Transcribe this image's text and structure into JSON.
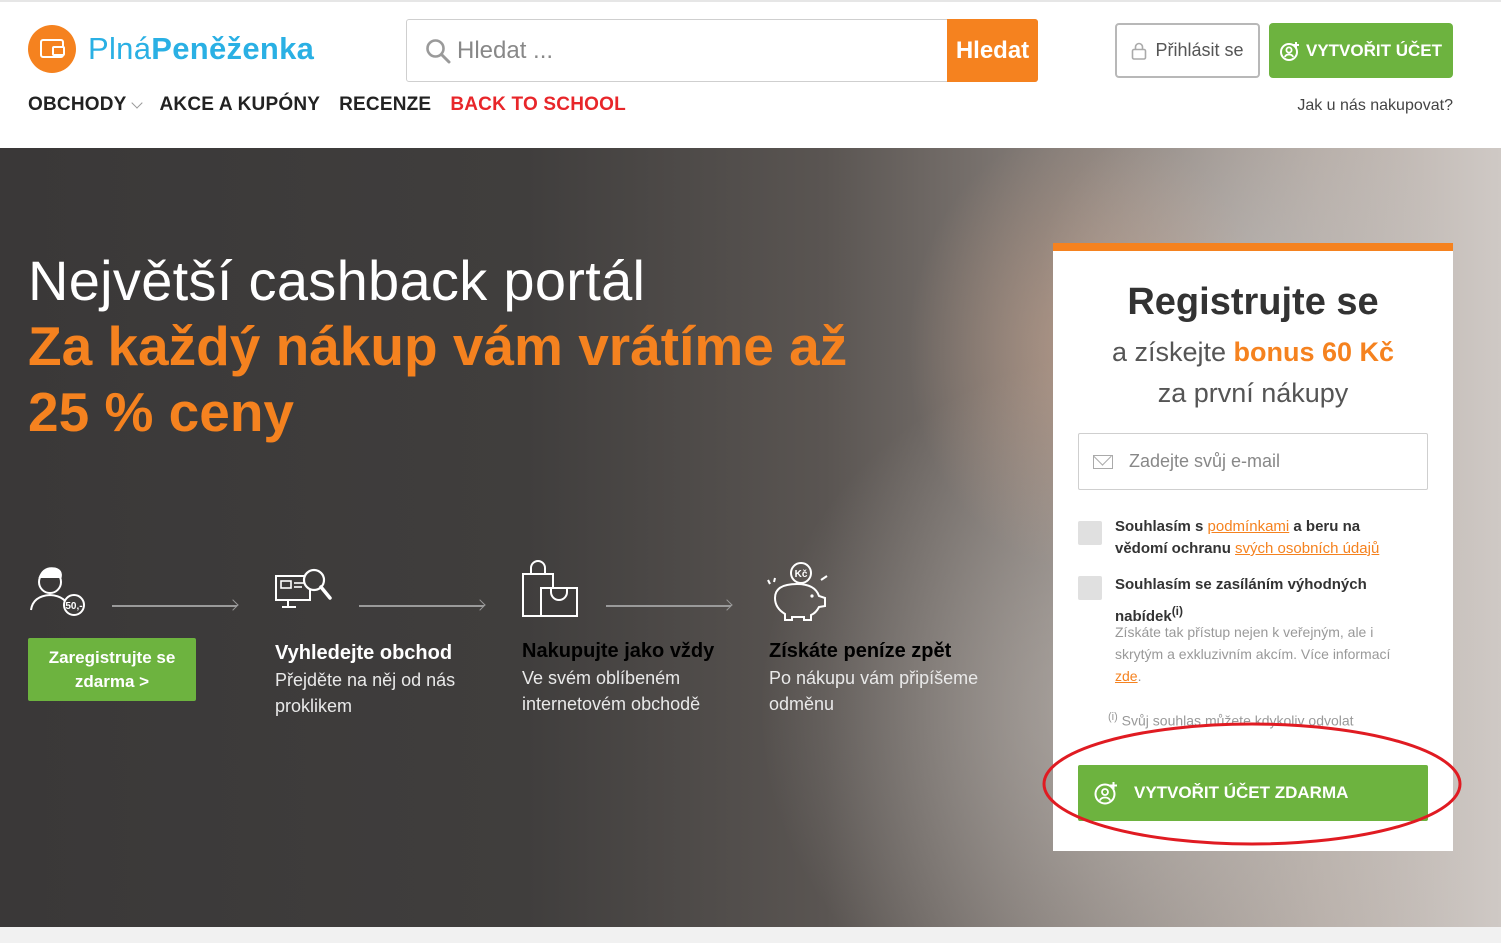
{
  "header": {
    "logo_part1": "Plná",
    "logo_part2": "Peněženka",
    "search_placeholder": "Hledat ...",
    "search_button": "Hledat",
    "login_label": "Přihlásit se",
    "create_account_label": "VYTVOŘIT ÚČET",
    "how_to_label": "Jak u nás nakupovat?",
    "nav": [
      {
        "label": "OBCHODY"
      },
      {
        "label": "AKCE A KUPÓNY"
      },
      {
        "label": "RECENZE"
      },
      {
        "label": "BACK TO SCHOOL"
      }
    ]
  },
  "hero": {
    "headline": "Největší cashback portál",
    "subheadline": "Za každý nákup vám vrátíme až 25 % ceny",
    "register_small": "Zaregistrujte se zdarma >",
    "steps": [
      {
        "icon": "user-coin-icon",
        "badge": "50,-"
      },
      {
        "icon": "search-shop-icon",
        "title": "Vyhledejte obchod",
        "desc": "Přejděte na něj od nás proklikem"
      },
      {
        "icon": "shopping-bag-icon",
        "title": "Nakupujte jako vždy",
        "desc": "Ve svém oblíbeném internetovém obchodě"
      },
      {
        "icon": "piggy-bank-icon",
        "title": "Získáte peníze zpět",
        "desc": "Po nákupu vám připíšeme odměnu",
        "badge": "Kč"
      }
    ]
  },
  "register": {
    "title": "Registrujte se",
    "sub_prefix": "a získejte ",
    "bonus": "bonus 60 Kč",
    "sub2": "za první nákupy",
    "email_placeholder": "Zadejte svůj e-mail",
    "consent1_prefix": "Souhlasím s ",
    "consent1_link1": "podmínkami",
    "consent1_mid": " a beru na vědomí ochranu ",
    "consent1_link2": "svých osobních údajů",
    "consent2": "Souhlasím se zasíláním výhodných nabídek",
    "consent2_sup": "(i)",
    "consent2_info": "Získáte tak přístup nejen k veřejným, ale i skrytým a exkluzivním akcím. Více informací ",
    "consent2_link": "zde",
    "consent2_end": ".",
    "note_sup": "(i)",
    "note": " Svůj souhlas můžete kdykoliv odvolat",
    "cta": "VYTVOŘIT ÚČET ZDARMA"
  },
  "colors": {
    "brand_orange": "#f5821f",
    "brand_blue": "#2ab0e4",
    "green": "#6db33f",
    "nav_red": "#e8262a",
    "annotation_red": "#e01b22"
  }
}
